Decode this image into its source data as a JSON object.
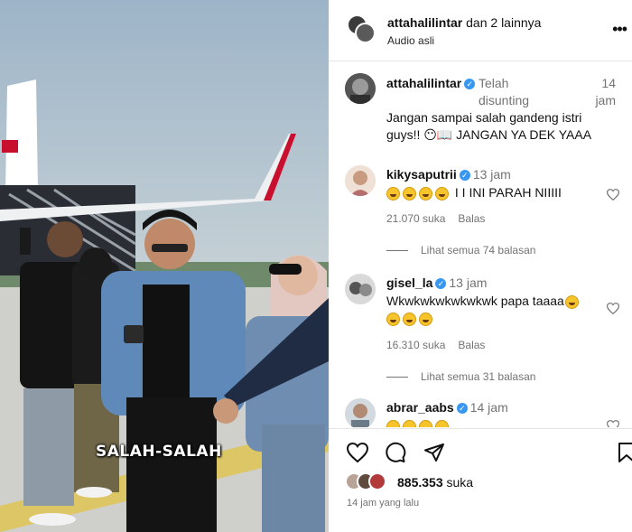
{
  "media": {
    "overlay_caption": "SALAH-SALAH"
  },
  "post_header": {
    "username": "attahalilintar",
    "collab_suffix": "dan 2 lainnya",
    "audio_label": "Audio asli",
    "more_icon": "more-icon"
  },
  "caption_comment": {
    "username": "attahalilintar",
    "edited_label": "Telah disunting",
    "time": "14 jam",
    "text": "Jangan sampai salah gandeng istri guys!! 😶📖 JANGAN YA DEK YAAA"
  },
  "comments": [
    {
      "username": "kikysaputrii",
      "time": "13 jam",
      "text": "I I INI PARAH NIIIII",
      "emoji_prefix_count": 4,
      "likes": "21.070 suka",
      "reply_label": "Balas",
      "view_replies": "Lihat semua 74 balasan"
    },
    {
      "username": "gisel_la",
      "time": "13 jam",
      "text": "Wkwkwkwkwkwkwk papa taaaa",
      "emoji_suffix_count": 1,
      "emoji_line_count": 3,
      "likes": "16.310 suka",
      "reply_label": "Balas",
      "view_replies": "Lihat semua 31 balasan"
    },
    {
      "username": "abrar_aabs",
      "time": "14 jam",
      "emoji_line_count": 4
    }
  ],
  "actions": {
    "like_icon": "heart-icon",
    "comment_icon": "comment-icon",
    "share_icon": "send-icon",
    "save_icon": "bookmark-icon",
    "likes_count": "885.353",
    "likes_suffix": "suka",
    "posted_ago": "14 jam yang lalu"
  },
  "colors": {
    "verified": "#3897f0",
    "gray_text": "#737373",
    "divider": "#e6e6e6"
  }
}
